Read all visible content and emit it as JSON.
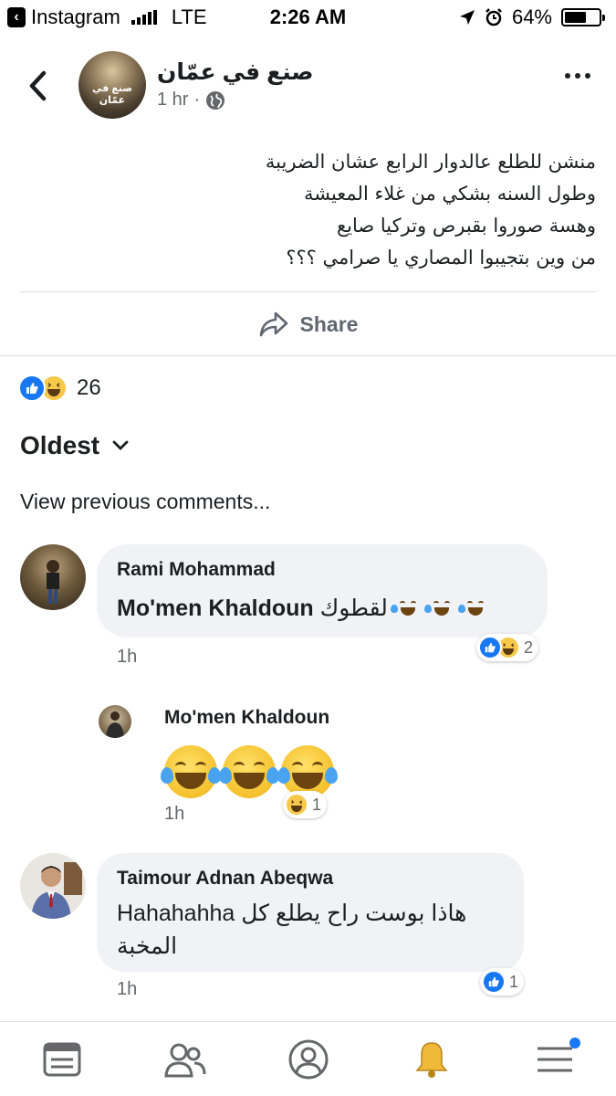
{
  "status_bar": {
    "app_back": "Instagram",
    "carrier": "LTE",
    "time": "2:26 AM",
    "battery": "64%",
    "battery_level": 0.64
  },
  "post": {
    "page_name": "صنع في عمّان",
    "time": "1 hr",
    "separator": "·",
    "avatar_label": "صنع في عمّان",
    "text_lines": [
      "منشن للطلع عالدوار الرابع عشان الضريبة",
      "وطول السنه بشكي من غلاء المعيشة",
      "وهسة صوروا بقبرص وتركيا  صايع",
      "من وين بتجيبوا المصاري يا صرامي  ؟؟؟"
    ],
    "share_label": "Share"
  },
  "reactions": {
    "count": "26"
  },
  "comments_section": {
    "sort_label": "Oldest",
    "view_previous": "View previous comments..."
  },
  "comments": [
    {
      "author": "Rami Mohammad",
      "mention": "Mo'men Khaldoun",
      "text": "لقطوك",
      "time": "1h",
      "reaction_count": "2"
    },
    {
      "author": "Mo'men Khaldoun",
      "time": "1h",
      "reaction_count": "1"
    },
    {
      "author": "Taimour Adnan Abeqwa",
      "text": "Hahahahha هاذا بوست راح يطلع كل المخبة",
      "time": "1h",
      "reaction_count": "1"
    }
  ],
  "colors": {
    "accent": "#1877f2",
    "bubble": "#f0f2f5",
    "secondary_text": "#65676b"
  },
  "tab_bar": {
    "icons": [
      "news-feed-icon",
      "friends-icon",
      "profile-icon",
      "notifications-bell-icon",
      "menu-icon"
    ],
    "active": "notifications-bell-icon"
  }
}
